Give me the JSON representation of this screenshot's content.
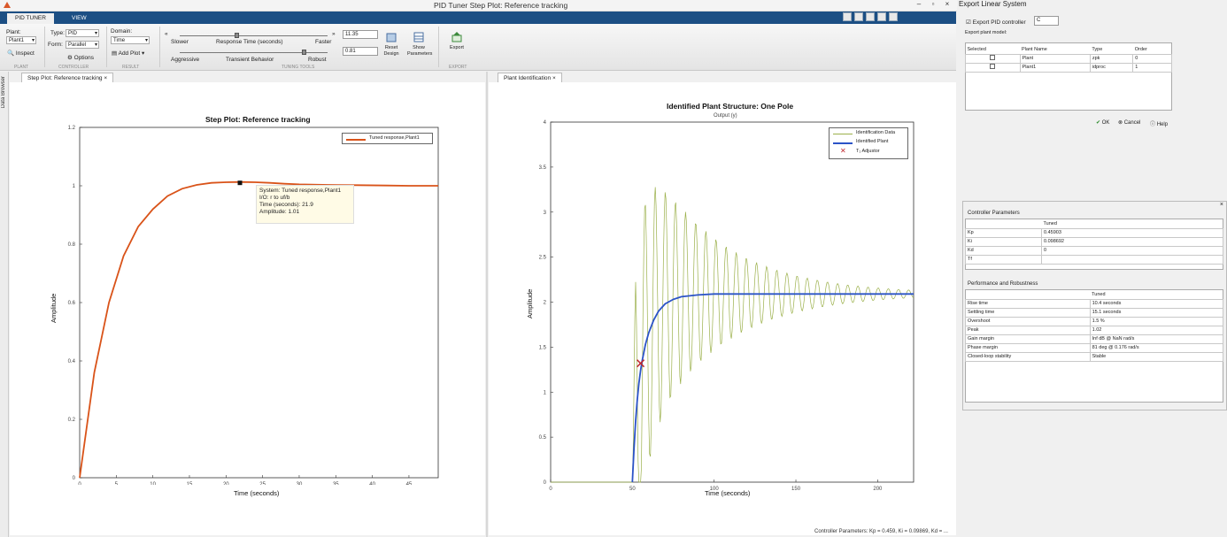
{
  "window": {
    "title": "PID Tuner   Step Plot: Reference tracking"
  },
  "tabs": [
    {
      "label": "PID TUNER"
    },
    {
      "label": "VIEW"
    }
  ],
  "toolstrip": {
    "plant_label": "Plant:",
    "plant_value": "Plant1",
    "inspect_label": "Inspect",
    "type_label": "Type:",
    "type_value": "PID",
    "form_label": "Form:",
    "form_value": "Parallel",
    "optimize_label": "Options",
    "domain_label": "Domain:",
    "domain_value": "Time",
    "add_plot_label": "Add Plot",
    "slower_label": "Slower",
    "faster_label": "Faster",
    "response_time_label": "Response Time (seconds)",
    "response_time_value": "11.35",
    "aggressive_label": "Aggressive",
    "robust_label": "Robust",
    "transient_label": "Transient Behavior",
    "transient_value": "0.81",
    "reset_label": "Reset",
    "reset_label2": "Design",
    "show_label": "Show",
    "show_label2": "Parameters",
    "export_label": "Export",
    "sections": [
      {
        "label": "PLANT"
      },
      {
        "label": "CONTROLLER"
      },
      {
        "label": "RESULT"
      },
      {
        "label": "TUNING TOOLS"
      },
      {
        "label": "EXPORT"
      }
    ]
  },
  "data_browser_label": "Data Browser",
  "left_plot": {
    "tab_label": "Step Plot: Reference tracking",
    "chart_data": {
      "type": "line",
      "title": "Step Plot: Reference tracking",
      "xlabel": "Time (seconds)",
      "ylabel": "Amplitude",
      "xlim": [
        0,
        49
      ],
      "ylim": [
        0,
        1.2
      ],
      "xticks": [
        "0",
        "5",
        "10",
        "15",
        "20",
        "25",
        "30",
        "35",
        "40",
        "45"
      ],
      "yticks": [
        "0",
        "0.2",
        "0.4",
        "0.6",
        "0.8",
        "1",
        "1.2"
      ],
      "series": [
        {
          "name": "Tuned response,Plant1",
          "color": "#d95319",
          "x": [
            0,
            2,
            4,
            6,
            8,
            10,
            12,
            14,
            16,
            18,
            20,
            21.9,
            24,
            26,
            28,
            30,
            34,
            38,
            42,
            45,
            49
          ],
          "y": [
            0,
            0.36,
            0.6,
            0.76,
            0.86,
            0.92,
            0.965,
            0.99,
            1.003,
            1.01,
            1.012,
            1.013,
            1.012,
            1.01,
            1.007,
            1.005,
            1.003,
            1.002,
            1.001,
            1.0,
            1.0
          ]
        }
      ],
      "datatip": {
        "x": 21.9,
        "y": 1.01,
        "line1": "System: Tuned response,Plant1",
        "line2": "I/O: r to uf/b",
        "line3": "Time (seconds): 21.9",
        "line4": "Amplitude: 1.01"
      },
      "legend": "top-right"
    }
  },
  "right_plot": {
    "tab_label": "Plant Identification",
    "chart_data": {
      "type": "line",
      "title": "Identified Plant Structure: One Pole",
      "subtitle": "Output (y)",
      "xlabel": "Time (seconds)",
      "ylabel": "Amplitude",
      "xlim": [
        0,
        222
      ],
      "ylim": [
        0,
        4
      ],
      "xticks": [
        "0",
        "50",
        "100",
        "150",
        "200"
      ],
      "yticks": [
        "0",
        "0.5",
        "1",
        "1.5",
        "2",
        "2.5",
        "3",
        "3.5",
        "4"
      ],
      "series": [
        {
          "name": "Identification Data",
          "color": "#9bb04a"
        },
        {
          "name": "Identified Plant",
          "color": "#2b53c7",
          "x": [
            50,
            51,
            52,
            53,
            54,
            55,
            56,
            58,
            60,
            63,
            66,
            70,
            75,
            80,
            90,
            100,
            120,
            150,
            222
          ],
          "y": [
            0,
            0.38,
            0.68,
            0.92,
            1.1,
            1.24,
            1.35,
            1.53,
            1.66,
            1.8,
            1.9,
            1.98,
            2.03,
            2.06,
            2.08,
            2.09,
            2.09,
            2.09,
            2.09
          ]
        }
      ],
      "adjustor": {
        "label": "T₁ Adjustor",
        "x": 55,
        "y": 1.32
      },
      "legend": "top-right"
    }
  },
  "export_dialog": {
    "title": "Export Linear System",
    "checkbox_label": "Export PID controller",
    "name_value": "C",
    "plant_model_label": "Export plant model:",
    "headers": [
      "Selected",
      "Plant Name",
      "Type",
      "Order"
    ],
    "rows": [
      [
        "",
        "Plant",
        "zpk",
        "0"
      ],
      [
        "",
        "Plant1",
        "idproc",
        "1"
      ]
    ],
    "ok_label": "OK",
    "cancel_label": "Cancel",
    "help_label": "Help"
  },
  "controller_panel": {
    "title": "Controller Parameters",
    "header": "Tuned",
    "rows": [
      [
        "Kp",
        "0.45903"
      ],
      [
        "Ki",
        "0.098692"
      ],
      [
        "Kd",
        "0"
      ],
      [
        "Tf",
        ""
      ]
    ]
  },
  "performance_panel": {
    "title": "Performance and Robustness",
    "header": "Tuned",
    "rows": [
      [
        "Rise time",
        "10.4 seconds"
      ],
      [
        "Settling time",
        "15.1 seconds"
      ],
      [
        "Overshoot",
        "1.5 %"
      ],
      [
        "Peak",
        "1.02"
      ],
      [
        "Gain margin",
        "Inf dB @ NaN rad/s"
      ],
      [
        "Phase margin",
        "81 deg @ 0.176 rad/s"
      ],
      [
        "Closed-loop stability",
        "Stable"
      ]
    ]
  },
  "status": {
    "text": "Controller Parameters: Kp = 0.459, Ki = 0.09869, Kd = ..."
  }
}
